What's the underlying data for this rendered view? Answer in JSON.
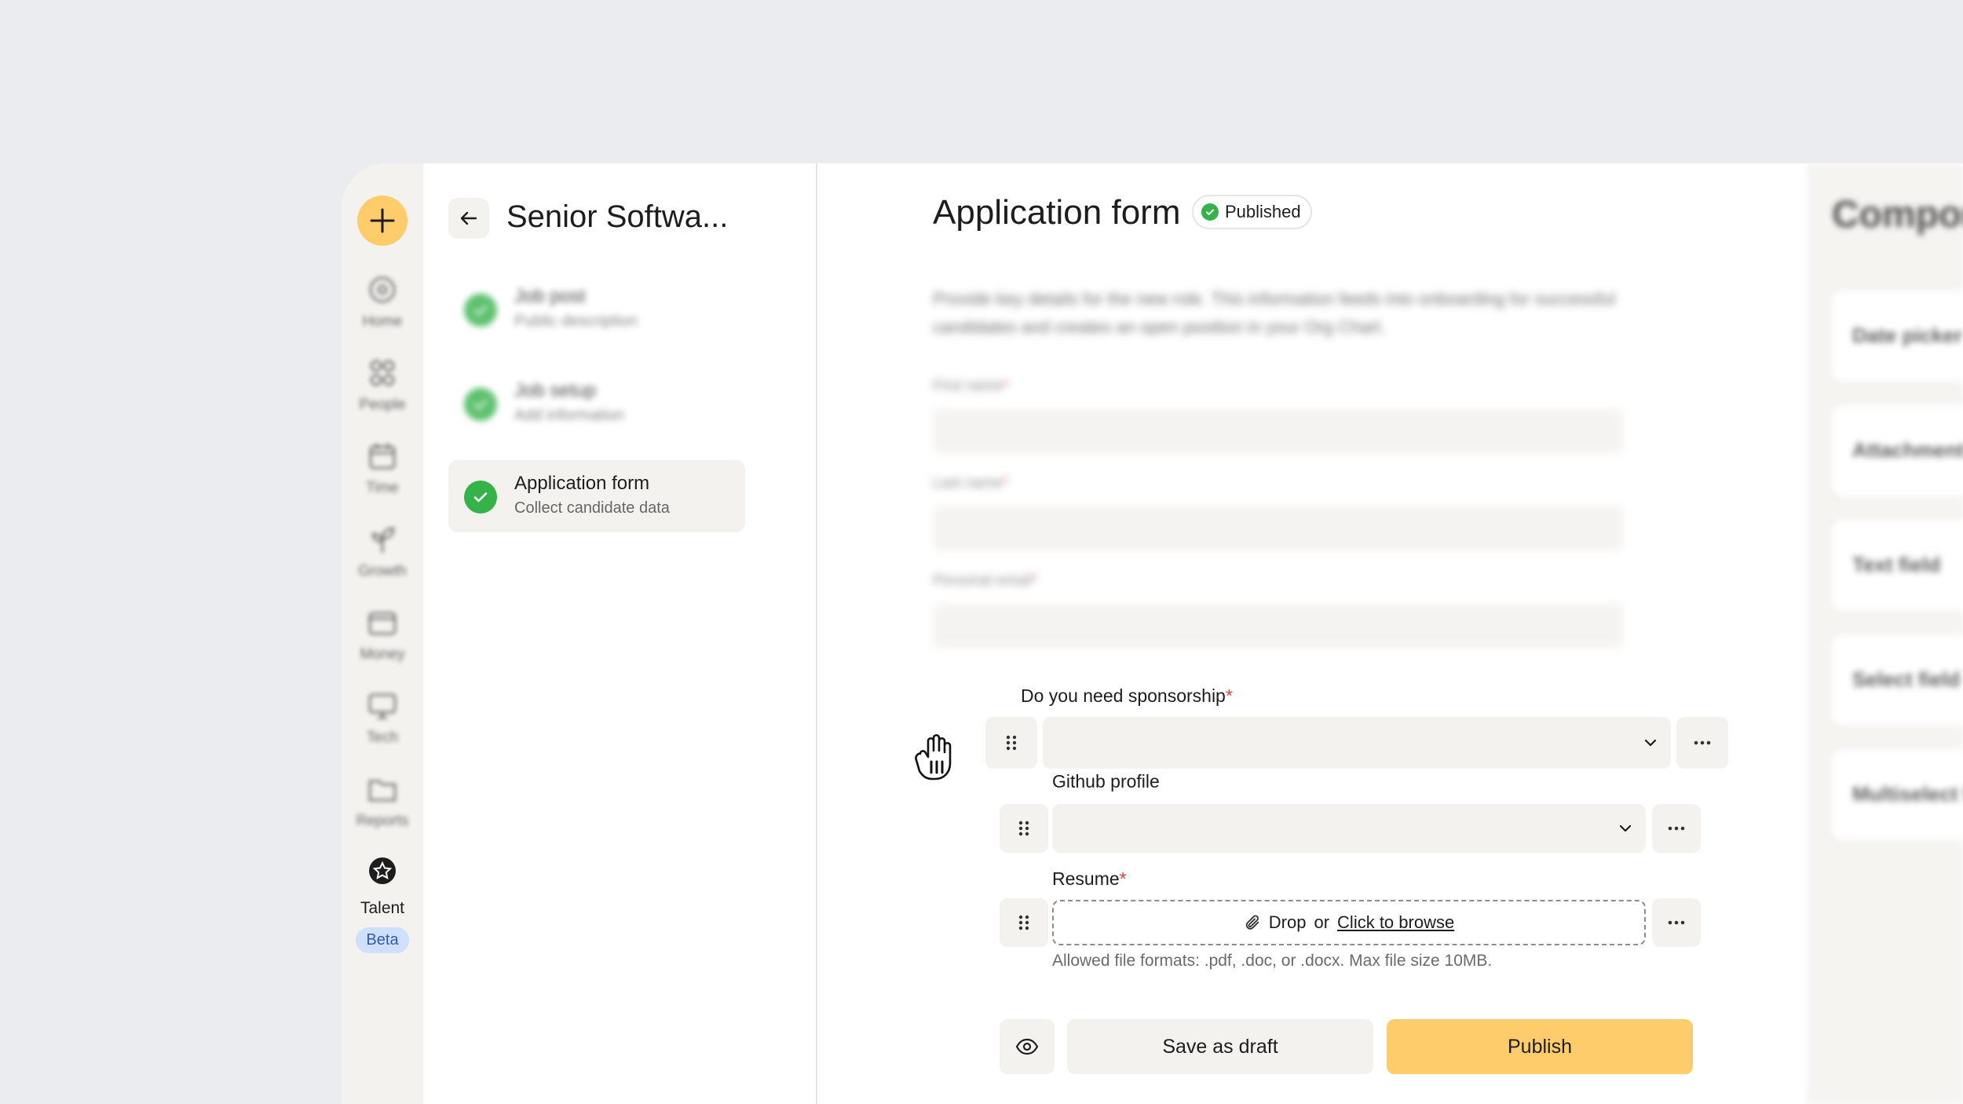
{
  "nav": {
    "items": [
      {
        "label": "Home",
        "icon": "home-icon"
      },
      {
        "label": "People",
        "icon": "people-icon"
      },
      {
        "label": "Time",
        "icon": "calendar-icon"
      },
      {
        "label": "Growth",
        "icon": "plant-icon"
      },
      {
        "label": "Money",
        "icon": "wallet-icon"
      },
      {
        "label": "Tech",
        "icon": "monitor-icon"
      },
      {
        "label": "Reports",
        "icon": "folder-icon"
      }
    ],
    "active": {
      "label": "Talent",
      "badge": "Beta"
    }
  },
  "steps": {
    "job_title": "Senior Softwa...",
    "items": [
      {
        "title": "Job post",
        "subtitle": "Public description"
      },
      {
        "title": "Job setup",
        "subtitle": "Add information"
      },
      {
        "title": "Application form",
        "subtitle": "Collect candidate data"
      }
    ]
  },
  "form": {
    "title": "Application form",
    "status": "Published",
    "description": "Provide key details for the new role. This information feeds into onboarding for successful candidates and creates an open position in your Org Chart.",
    "fields": [
      {
        "label": "First name",
        "required": "*"
      },
      {
        "label": "Last name",
        "required": "*"
      },
      {
        "label": "Personal email",
        "required": "*"
      }
    ],
    "questions": {
      "sponsorship": {
        "label": "Do you need sponsorship",
        "required": "*"
      },
      "github": {
        "label": "Github profile"
      },
      "resume": {
        "label": "Resume",
        "required": "*"
      }
    },
    "dropzone": {
      "drop": "Drop",
      "or": "or",
      "browse": "Click to browse"
    },
    "hint": "Allowed file formats: .pdf, .doc, or .docx. Max file size 10MB.",
    "actions": {
      "save": "Save as draft",
      "publish": "Publish"
    }
  },
  "components": {
    "title": "Components",
    "items": [
      "Date picker",
      "Attachment",
      "Text field",
      "Select field",
      "Multiselect field"
    ]
  }
}
